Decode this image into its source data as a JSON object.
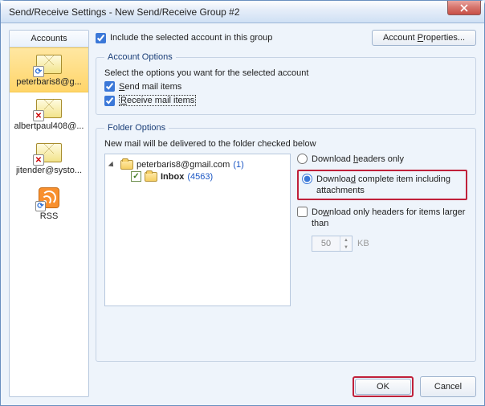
{
  "window": {
    "title": "Send/Receive Settings - New Send/Receive Group #2"
  },
  "sidebar": {
    "header": "Accounts",
    "items": [
      {
        "label": "peterbaris8@g..."
      },
      {
        "label": "albertpaul408@..."
      },
      {
        "label": "jitender@systo..."
      },
      {
        "label": "RSS"
      }
    ]
  },
  "top": {
    "include_label": "Include the selected account in this group",
    "acct_props": "Account Properties..."
  },
  "acct_opts": {
    "legend": "Account Options",
    "desc": "Select the options you want for the selected account",
    "send": "Send mail items",
    "recv": "Receive mail items"
  },
  "folder_opts": {
    "legend": "Folder Options",
    "desc": "New mail will be delivered to the folder checked below",
    "tree": {
      "root": "peterbaris8@gmail.com",
      "root_count": "(1)",
      "inbox": "Inbox",
      "inbox_count": "(4563)"
    },
    "dl_headers": "Download headers only",
    "dl_full": "Download complete item including attachments",
    "dl_limit": "Download only headers for items larger than",
    "size_val": "50",
    "kb": "KB"
  },
  "buttons": {
    "ok": "OK",
    "cancel": "Cancel"
  }
}
